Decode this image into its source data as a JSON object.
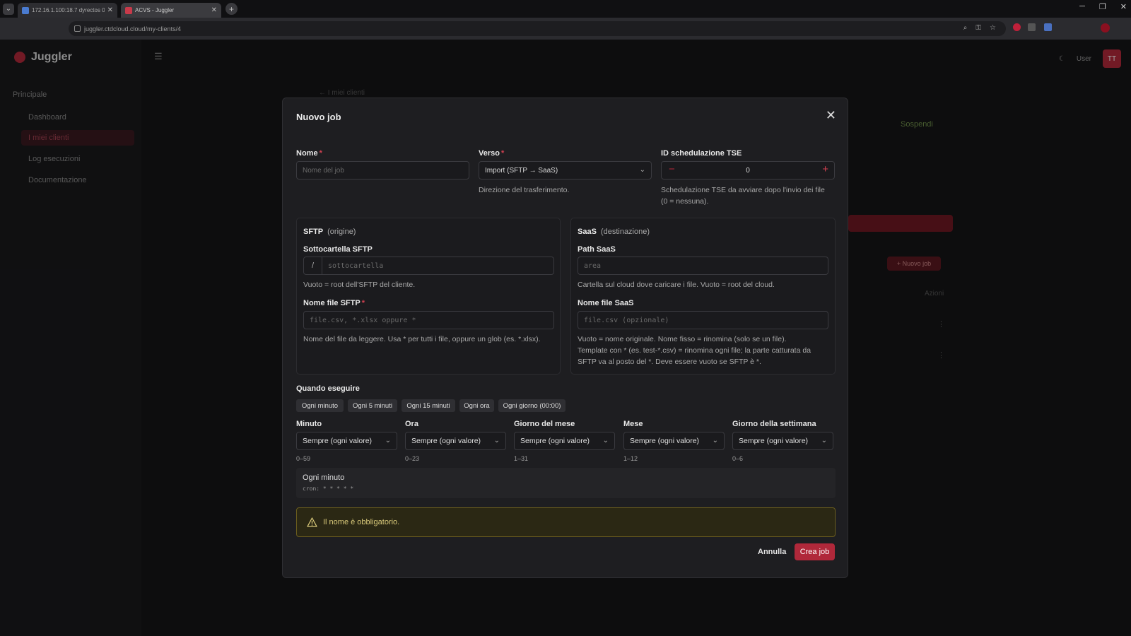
{
  "browser": {
    "tabs": [
      {
        "title": "172.16.1.100:18.7 dyrectos 0"
      },
      {
        "title": "ACVS - Juggler"
      }
    ],
    "url": "juggler.ctdcloud.cloud/my-clients/4"
  },
  "app": {
    "brand": "Juggler",
    "sidebar": {
      "group": "Principale",
      "items": [
        "Dashboard",
        "I miei clienti",
        "Log esecuzioni",
        "Documentazione"
      ]
    },
    "user": "User",
    "avatar_initials": "TT",
    "bg": {
      "breadcrumb": "← I miei clienti",
      "suspend": "Sospendi",
      "new_job": "+ Nuovo job",
      "actions": "Azioni"
    }
  },
  "modal": {
    "title": "Nuovo job",
    "nome": {
      "label": "Nome",
      "placeholder": "Nome del job"
    },
    "verso": {
      "label": "Verso",
      "value": "Import (SFTP → SaaS)",
      "help": "Direzione del trasferimento."
    },
    "tse": {
      "label": "ID schedulazione TSE",
      "value": "0",
      "help_1": "Schedulazione TSE da avviare dopo l'invio dei file",
      "help_2": "(0 = nessuna)."
    },
    "sftp": {
      "title": "SFTP",
      "subtitle": "(origine)",
      "folder_label": "Sottocartella SFTP",
      "folder_prefix": "/",
      "folder_placeholder": "sottocartella",
      "folder_help": "Vuoto = root dell'SFTP del cliente.",
      "file_label": "Nome file SFTP",
      "file_placeholder": "file.csv, *.xlsx oppure *",
      "file_help": "Nome del file da leggere. Usa * per tutti i file, oppure un glob (es. *.xlsx)."
    },
    "saas": {
      "title": "SaaS",
      "subtitle": "(destinazione)",
      "path_label": "Path SaaS",
      "path_placeholder": "area",
      "path_help": "Cartella sul cloud dove caricare i file. Vuoto = root del cloud.",
      "file_label": "Nome file SaaS",
      "file_placeholder": "file.csv (opzionale)",
      "file_help_1": "Vuoto = nome originale. Nome fisso = rinomina (solo se un file).",
      "file_help_2": "Template con * (es. test-*.csv) = rinomina ogni file; la parte catturata da",
      "file_help_3": "SFTP va al posto del *. Deve essere vuoto se SFTP è *."
    },
    "schedule": {
      "label": "Quando eseguire",
      "presets": [
        "Ogni minuto",
        "Ogni 5 minuti",
        "Ogni 15 minuti",
        "Ogni ora",
        "Ogni giorno (00:00)"
      ],
      "fields": [
        {
          "label": "Minuto",
          "value": "Sempre (ogni valore)",
          "range": "0–59"
        },
        {
          "label": "Ora",
          "value": "Sempre (ogni valore)",
          "range": "0–23"
        },
        {
          "label": "Giorno del mese",
          "value": "Sempre (ogni valore)",
          "range": "1–31"
        },
        {
          "label": "Mese",
          "value": "Sempre (ogni valore)",
          "range": "1–12"
        },
        {
          "label": "Giorno della settimana",
          "value": "Sempre (ogni valore)",
          "range": "0–6"
        }
      ],
      "summary": "Ogni minuto",
      "cron": "cron: * * * * *"
    },
    "alert": "Il nome è obbligatorio.",
    "cancel": "Annulla",
    "create": "Crea job"
  }
}
